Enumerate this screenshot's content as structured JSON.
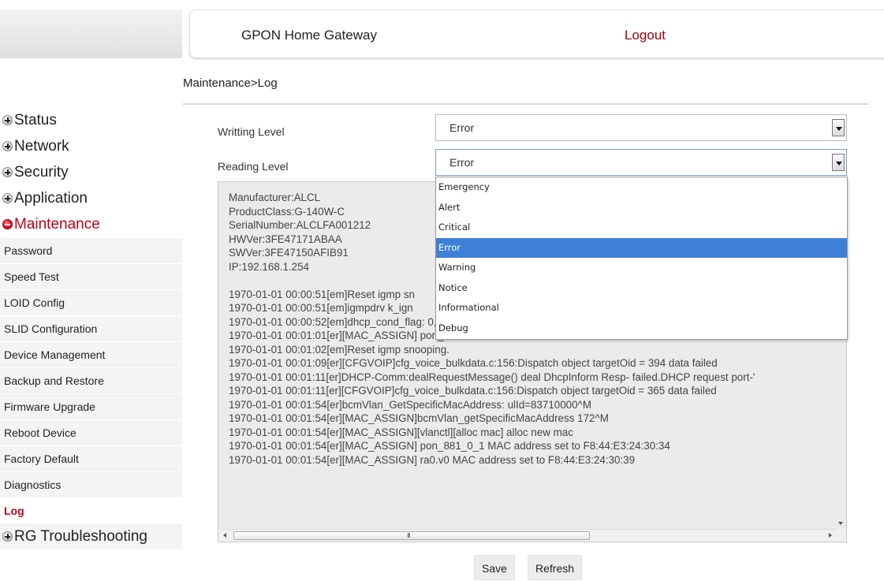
{
  "header": {
    "title": "GPON Home Gateway",
    "logout": "Logout"
  },
  "breadcrumb": "Maintenance>Log",
  "sidebar": {
    "main_items": [
      {
        "label": "Status",
        "icon": "plus-circle-icon"
      },
      {
        "label": "Network",
        "icon": "plus-circle-icon"
      },
      {
        "label": "Security",
        "icon": "plus-circle-icon"
      },
      {
        "label": "Application",
        "icon": "plus-circle-icon"
      },
      {
        "label": "Maintenance",
        "icon": "minus-circle-icon",
        "active": true
      }
    ],
    "sub_items": [
      "Password",
      "Speed Test",
      "LOID Config",
      "SLID Configuration",
      "Device Management",
      "Backup and Restore",
      "Firmware Upgrade",
      "Reboot Device",
      "Factory Default",
      "Diagnostics",
      "Log"
    ],
    "active_sub": "Log",
    "last_item": {
      "label": "RG Troubleshooting",
      "icon": "plus-circle-icon"
    }
  },
  "form": {
    "writing_level_label": "Writting Level",
    "writing_level_value": "Error",
    "reading_level_label": "Reading Level",
    "reading_level_value": "Error"
  },
  "dropdown": {
    "options": [
      "Emergency",
      "Alert",
      "Critical",
      "Error",
      "Warning",
      "Notice",
      "Informational",
      "Debug"
    ],
    "selected": "Error"
  },
  "log": {
    "lines": [
      "Manufacturer:ALCL",
      "ProductClass:G-140W-C",
      "SerialNumber:ALCLFA001212",
      "HWVer:3FE47171ABAA",
      "SWVer:3FE47150AFIB91",
      "IP:192.168.1.254",
      "",
      "1970-01-01 00:00:51[em]Reset igmp sn",
      "1970-01-01 00:00:51[em]igmpdrv k_ign",
      "1970-01-01 00:00:52[em]dhcp_cond_flag: 0, dhcp_pool_iptv_count: 0",
      "1970-01-01 00:01:01[er][MAC_ASSIGN] pon_d4097 MAC address set to 02:4C:FA:00:12:12",
      "1970-01-01 00:01:02[em]Reset igmp snooping.",
      "1970-01-01 00:01:09[er][CFGVOIP]cfg_voice_bulkdata.c:156:Dispatch object targetOid = 394 data failed",
      "1970-01-01 00:01:11[er]DHCP-Comm:dealRequestMessage() deal DhcpInform Resp- failed.DHCP request port-'",
      "1970-01-01 00:01:11[er][CFGVOIP]cfg_voice_bulkdata.c:156:Dispatch object targetOid = 365 data failed",
      "1970-01-01 00:01:54[er]bcmVlan_GetSpecificMacAddress: ulId=83710000^M",
      "1970-01-01 00:01:54[er][MAC_ASSIGN]bcmVlan_getSpecificMacAddress 172^M",
      "1970-01-01 00:01:54[er][MAC_ASSIGN][vlanctl][alloc mac] alloc new mac",
      "1970-01-01 00:01:54[er][MAC_ASSIGN] pon_881_0_1 MAC address set to F8:44:E3:24:30:34",
      "1970-01-01 00:01:54[er][MAC_ASSIGN] ra0.v0 MAC address set to F8:44:E3:24:30:39"
    ]
  },
  "buttons": {
    "save": "Save",
    "refresh": "Refresh"
  },
  "colors": {
    "accent": "#c0001a",
    "selected_option": "#3e80d6",
    "log_background": "#ebebeb"
  }
}
